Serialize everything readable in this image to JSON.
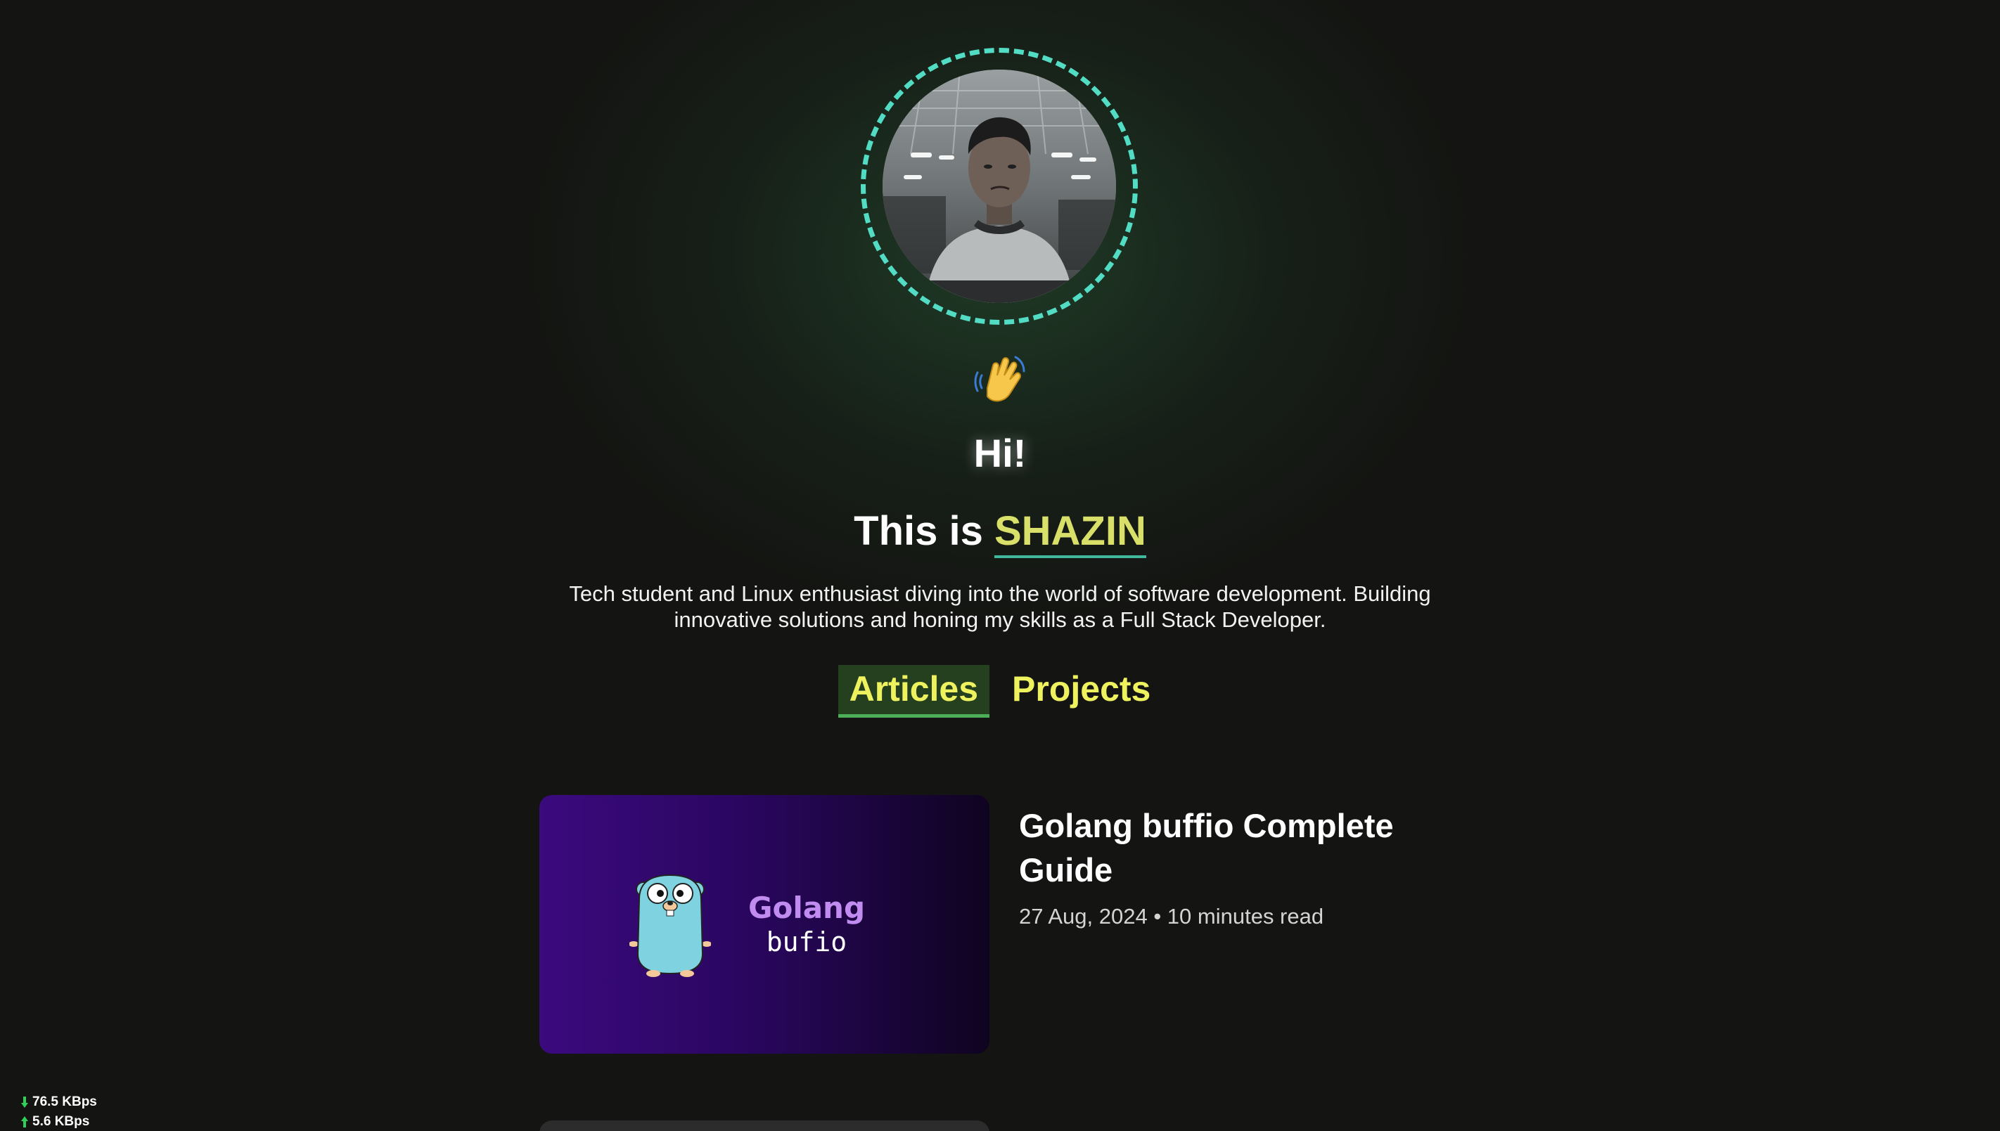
{
  "hero": {
    "greeting": "Hi!",
    "intro_prefix": "This is ",
    "name": "SHAZIN",
    "bio": "Tech student and Linux enthusiast diving into the world of software development. Building innovative solutions and honing my skills as a Full Stack Developer.",
    "avatar_icon": "profile-photo",
    "wave_icon": "waving-hand-emoji"
  },
  "tabs": [
    {
      "label": "Articles",
      "active": true
    },
    {
      "label": "Projects",
      "active": false
    }
  ],
  "articles": [
    {
      "thumbnail_title": "Golang",
      "thumbnail_subtitle": "bufio",
      "thumbnail_icon": "gopher-mascot",
      "title": "Golang buffio Complete Guide",
      "meta": "27 Aug, 2024 • 10 minutes read"
    }
  ],
  "netspeed": {
    "download": "76.5 KBps",
    "upload": "5.6 KBps"
  },
  "colors": {
    "background": "#141512",
    "accent_yellow": "#eef25e",
    "name_color": "#d8e06a",
    "ring_color": "#52dcc4",
    "tab_active_bg": "#24401f",
    "tab_active_border": "#4cae57"
  }
}
